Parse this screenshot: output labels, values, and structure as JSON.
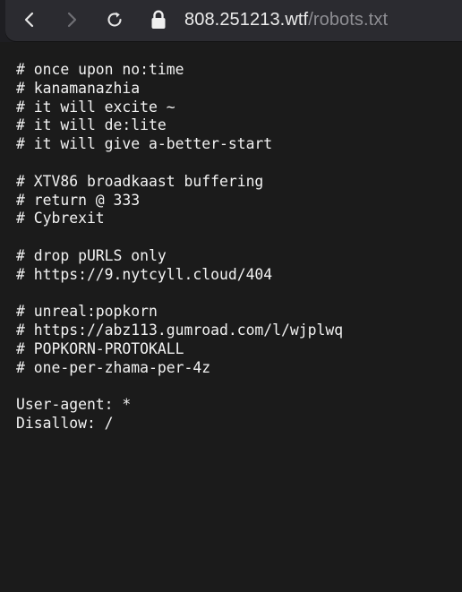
{
  "browser": {
    "url_prefix": "808.",
    "url_host": "251213.wtf",
    "url_path": "/robots.txt",
    "icons": {
      "back": "chevron-left-icon",
      "forward": "chevron-right-icon",
      "reload": "reload-icon",
      "lock": "lock-icon"
    }
  },
  "document": {
    "lines": [
      "# once upon no:time",
      "# kanamanazhia",
      "# it will excite ~",
      "# it will de:lite",
      "# it will give a-better-start",
      "",
      "# XTV86 broadkaast buffering",
      "# return @ 333",
      "# Cybrexit",
      "",
      "# drop pURLS only",
      "# https://9.nytcyll.cloud/404",
      "",
      "# unreal:popkorn",
      "# https://abz113.gumroad.com/l/wjplwq",
      "# POPKORN-PROTOKALL",
      "# one-per-zhama-per-4z",
      "",
      "User-agent: *",
      "Disallow: /"
    ]
  }
}
